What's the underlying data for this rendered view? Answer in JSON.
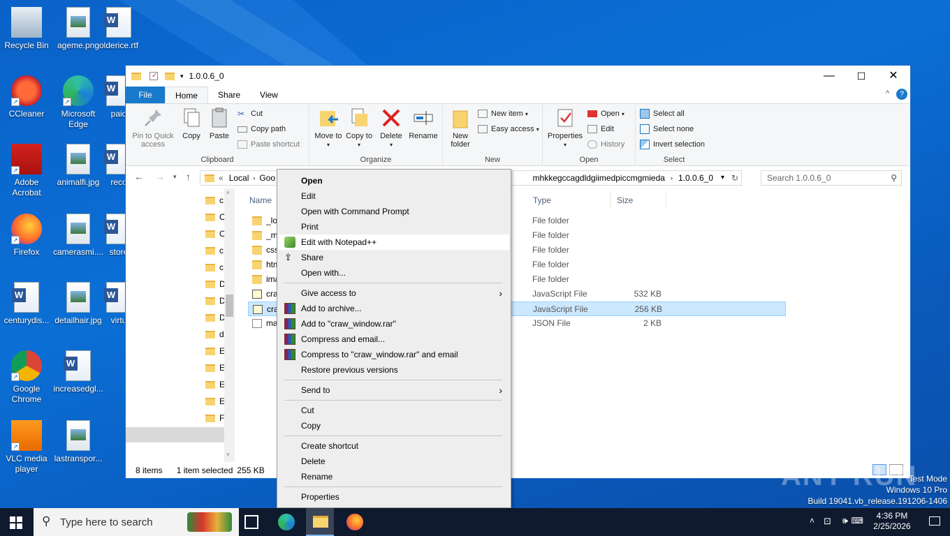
{
  "desktop": {
    "icons": [
      {
        "label": "Recycle Bin",
        "icon": "recycle-bin-icon"
      },
      {
        "label": "ageme.png",
        "icon": "image-file-icon"
      },
      {
        "label": "olderice.rtf",
        "icon": "word-document-icon"
      },
      {
        "label": "CCleaner",
        "icon": "ccleaner-icon"
      },
      {
        "label": "Microsoft Edge",
        "icon": "edge-icon"
      },
      {
        "label": "paid",
        "icon": "word-document-icon"
      },
      {
        "label": "Adobe Acrobat",
        "icon": "acrobat-icon"
      },
      {
        "label": "animalfi.jpg",
        "icon": "image-file-icon"
      },
      {
        "label": "reco",
        "icon": "word-document-icon"
      },
      {
        "label": "Firefox",
        "icon": "firefox-icon"
      },
      {
        "label": "camerasmi....",
        "icon": "image-file-icon"
      },
      {
        "label": "store",
        "icon": "word-document-icon"
      },
      {
        "label": "centurydis...",
        "icon": "word-document-icon"
      },
      {
        "label": "detailhair.jpg",
        "icon": "image-file-icon"
      },
      {
        "label": "virtu",
        "icon": "word-document-icon"
      },
      {
        "label": "Google Chrome",
        "icon": "chrome-icon"
      },
      {
        "label": "increasedgl...",
        "icon": "word-document-icon"
      },
      {
        "label": "VLC media player",
        "icon": "vlc-icon"
      },
      {
        "label": "lastranspor...",
        "icon": "image-file-icon"
      }
    ]
  },
  "window": {
    "title": "1.0.0.6_0",
    "controls": {
      "minimize": "—",
      "maximize": "☐",
      "close": "✕"
    },
    "tabs": [
      "File",
      "Home",
      "Share",
      "View"
    ],
    "ribbon": {
      "clipboard": {
        "label": "Clipboard",
        "pin": "Pin to Quick access",
        "copy": "Copy",
        "paste": "Paste",
        "cut": "Cut",
        "copy_path": "Copy path",
        "paste_shortcut": "Paste shortcut"
      },
      "organize": {
        "label": "Organize",
        "move_to": "Move to",
        "copy_to": "Copy to",
        "delete": "Delete",
        "rename": "Rename"
      },
      "new": {
        "label": "New",
        "new_folder": "New folder",
        "new_item": "New item",
        "easy_access": "Easy access"
      },
      "open": {
        "label": "Open",
        "properties": "Properties",
        "open": "Open",
        "edit": "Edit",
        "history": "History"
      },
      "select": {
        "label": "Select",
        "select_all": "Select all",
        "select_none": "Select none",
        "invert": "Invert selection"
      }
    },
    "address": {
      "prefix": "«",
      "seg1": "Local",
      "seg2": "Goo",
      "seg3": "mhkkegccagdldgiimedpiccmgmieda",
      "seg4": "1.0.0.6_0",
      "search_placeholder": "Search 1.0.0.6_0"
    },
    "tree": [
      "c",
      "C",
      "C",
      "c",
      "c",
      "D",
      "D",
      "D",
      "d",
      "E",
      "E",
      "E",
      "E",
      "F"
    ],
    "columns": {
      "name": "Name",
      "type": "Type",
      "size": "Size"
    },
    "files": [
      {
        "name": "_loc",
        "type": "File folder",
        "size": "",
        "kind": "folder"
      },
      {
        "name": "_m",
        "type": "File folder",
        "size": "",
        "kind": "folder"
      },
      {
        "name": "css",
        "type": "File folder",
        "size": "",
        "kind": "folder"
      },
      {
        "name": "htm",
        "type": "File folder",
        "size": "",
        "kind": "folder"
      },
      {
        "name": "ima",
        "type": "File folder",
        "size": "",
        "kind": "folder"
      },
      {
        "name": "cra",
        "type": "JavaScript File",
        "size": "532 KB",
        "kind": "js"
      },
      {
        "name": "cra",
        "type": "JavaScript File",
        "size": "256 KB",
        "kind": "js"
      },
      {
        "name": "ma",
        "type": "JSON File",
        "size": "2 KB",
        "kind": "json"
      }
    ],
    "status": {
      "items": "8 items",
      "selected": "1 item selected",
      "size": "255 KB"
    }
  },
  "context_menu": {
    "items": [
      {
        "label": "Open",
        "bold": true
      },
      {
        "label": "Edit"
      },
      {
        "label": "Open with Command Prompt"
      },
      {
        "label": "Print"
      },
      {
        "label": "Edit with Notepad++",
        "icon": "notepadpp-icon",
        "highlight": true
      },
      {
        "label": "Share",
        "icon": "share-icon"
      },
      {
        "label": "Open with..."
      },
      {
        "label": "Give access to",
        "submenu": true
      },
      {
        "label": "Add to archive...",
        "icon": "winrar-icon"
      },
      {
        "label": "Add to \"craw_window.rar\"",
        "icon": "winrar-icon"
      },
      {
        "label": "Compress and email...",
        "icon": "winrar-icon"
      },
      {
        "label": "Compress to \"craw_window.rar\" and email",
        "icon": "winrar-icon"
      },
      {
        "label": "Restore previous versions"
      },
      {
        "label": "Send to",
        "submenu": true
      },
      {
        "label": "Cut"
      },
      {
        "label": "Copy"
      },
      {
        "label": "Create shortcut"
      },
      {
        "label": "Delete"
      },
      {
        "label": "Rename"
      },
      {
        "label": "Properties"
      }
    ]
  },
  "taskbar": {
    "search_placeholder": "Type here to search",
    "time": "4:36 PM",
    "date": "2/25/2026"
  },
  "watermark": {
    "line1": "Test Mode",
    "line2": "Windows 10 Pro",
    "line3": "Build 19041.vb_release.191206-1406",
    "brand": "ANY RUN"
  }
}
